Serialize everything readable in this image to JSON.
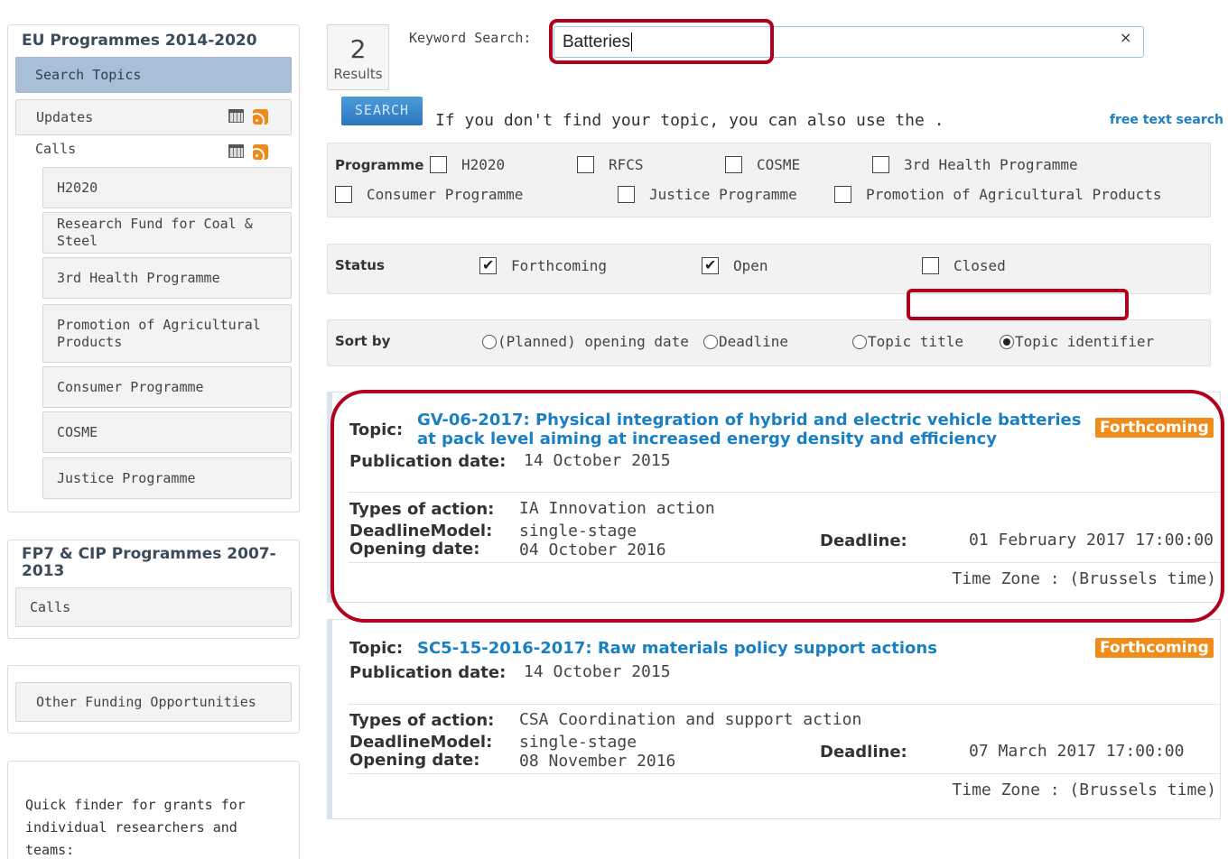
{
  "sidebar": {
    "eu": {
      "title": "EU Programmes 2014-2020",
      "search_topics": "Search Topics",
      "updates": "Updates",
      "calls": "Calls",
      "sub_items": [
        "H2020",
        "Research Fund for Coal & Steel",
        "3rd Health Programme",
        "Promotion of Agricultural Products",
        "Consumer Programme",
        "COSME",
        "Justice Programme"
      ]
    },
    "fp7": {
      "title": "FP7 & CIP Programmes 2007-2013",
      "calls": "Calls"
    },
    "other": {
      "label": "Other Funding Opportunities"
    },
    "quick": {
      "text": "Quick finder for grants for individual researchers and teams:"
    }
  },
  "search": {
    "count": "2",
    "count_label": "Results",
    "keyword_label": "Keyword Search:",
    "keyword_value": "Batteries",
    "clear_symbol": "×",
    "button_label": "SEARCH",
    "hint": "If you don't find your topic, you can also use the .",
    "free_text_link": "free text search"
  },
  "filters": {
    "programme_label": "Programme",
    "programmes": [
      {
        "label": "H2020",
        "checked": false
      },
      {
        "label": "RFCS",
        "checked": false
      },
      {
        "label": "COSME",
        "checked": false
      },
      {
        "label": "3rd Health Programme",
        "checked": false
      },
      {
        "label": "Consumer Programme",
        "checked": false
      },
      {
        "label": "Justice Programme",
        "checked": false
      },
      {
        "label": "Promotion of Agricultural Products",
        "checked": false
      }
    ],
    "status_label": "Status",
    "statuses": [
      {
        "label": "Forthcoming",
        "checked": true
      },
      {
        "label": "Open",
        "checked": true
      },
      {
        "label": "Closed",
        "checked": false
      }
    ],
    "sort_label": "Sort by",
    "sort_options": [
      {
        "label": "(Planned) opening date",
        "selected": false
      },
      {
        "label": "Deadline",
        "selected": false
      },
      {
        "label": "Topic title",
        "selected": false
      },
      {
        "label": "Topic identifier",
        "selected": true
      }
    ]
  },
  "results": [
    {
      "topic_label": "Topic:",
      "title_line1": "GV-06-2017: Physical integration of hybrid and electric vehicle batteries",
      "title_line2": "at pack level aiming at increased energy density and efficiency",
      "status": "Forthcoming",
      "publication_label": "Publication date:",
      "publication_date": "14 October 2015",
      "types_label": "Types of action:",
      "types_value": "IA Innovation action",
      "model_label": "DeadlineModel:",
      "model_value": "single-stage",
      "opening_label": "Opening date:",
      "opening_value": "04 October 2016",
      "deadline_label": "Deadline:",
      "deadline_value": "01 February 2017 17:00:00",
      "timezone": "Time Zone : (Brussels time)"
    },
    {
      "topic_label": "Topic:",
      "title_line1": "SC5-15-2016-2017: Raw materials policy support actions",
      "status": "Forthcoming",
      "publication_label": "Publication date:",
      "publication_date": "14 October 2015",
      "types_label": "Types of action:",
      "types_value": "CSA Coordination and support action",
      "model_label": "DeadlineModel:",
      "model_value": "single-stage",
      "opening_label": "Opening date:",
      "opening_value": "08 November 2016",
      "deadline_label": "Deadline:",
      "deadline_value": "07 March 2017 17:00:00",
      "timezone": "Time Zone : (Brussels time)"
    }
  ],
  "colors": {
    "link": "#1a80c2",
    "badge": "#f08c1a",
    "highlight": "#b0001d",
    "active_nav": "#a9bfd8"
  }
}
